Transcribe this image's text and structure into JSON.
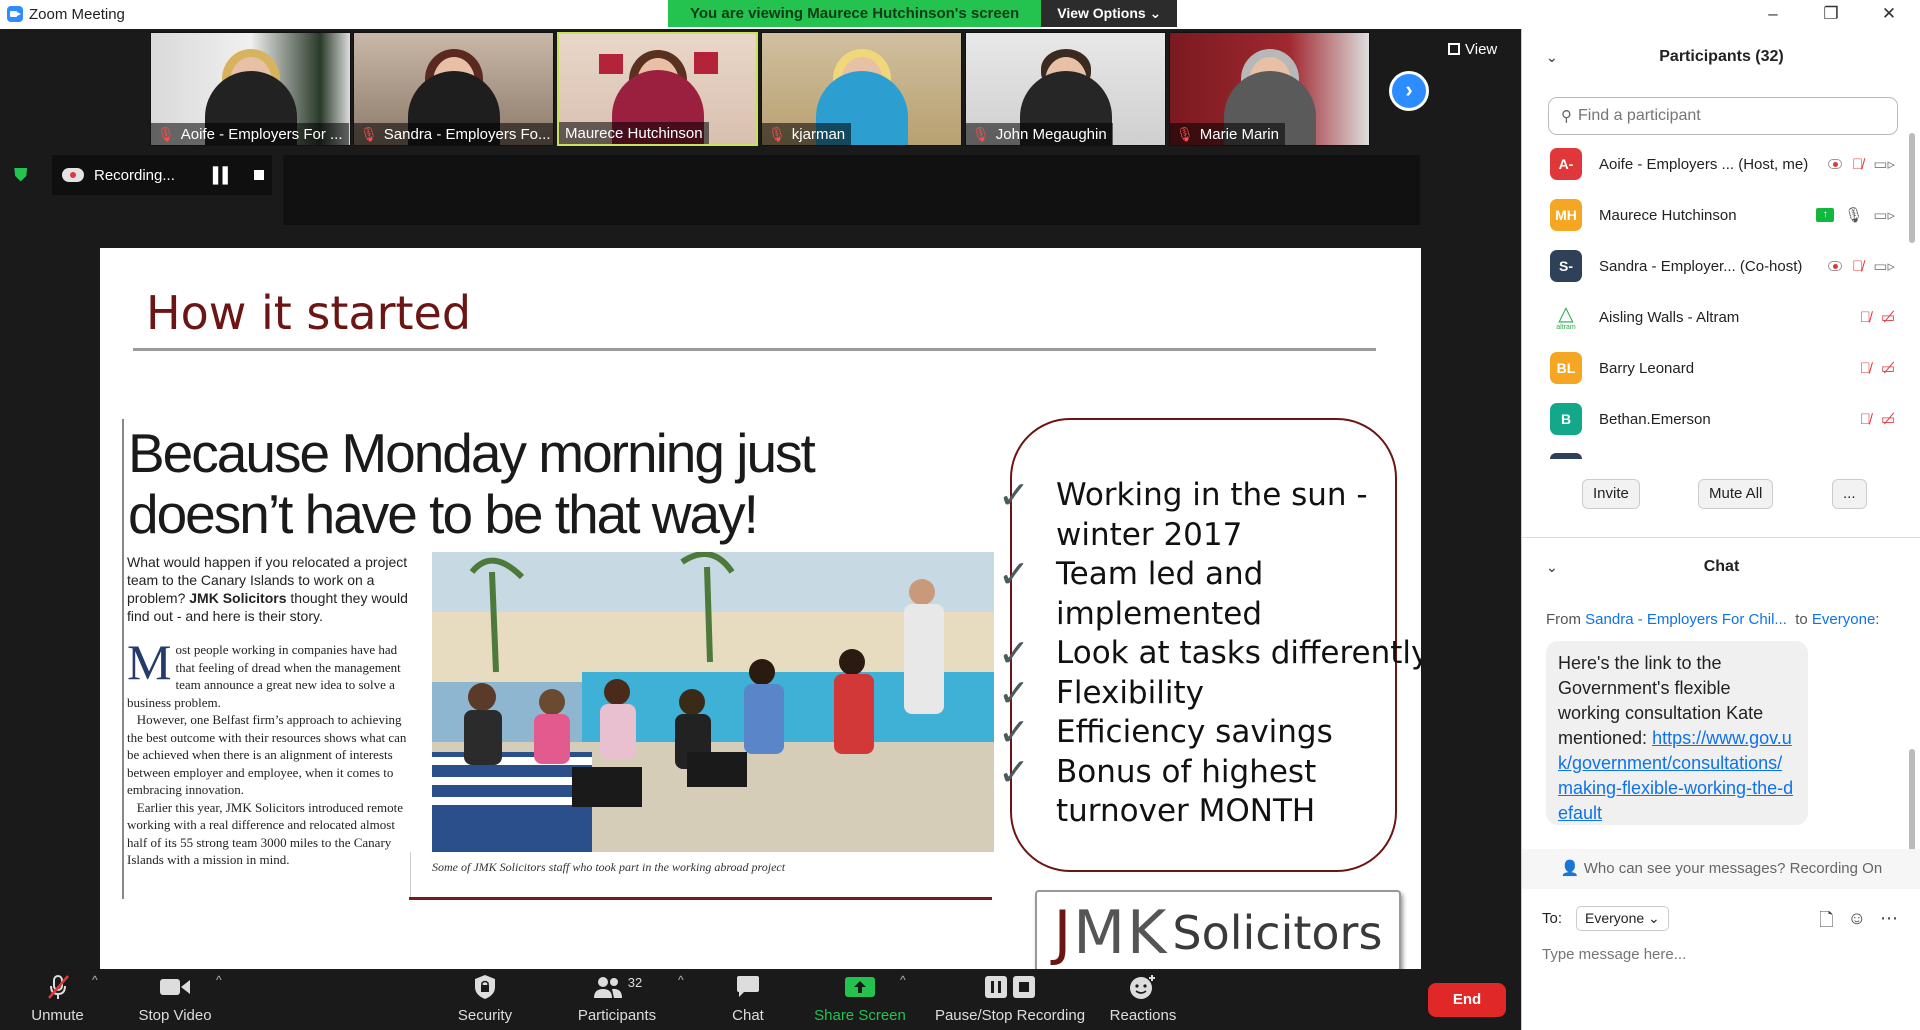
{
  "window": {
    "title": "Zoom Meeting",
    "minimize": "–",
    "maximize": "❐",
    "close": "✕"
  },
  "banner": {
    "text": "You are viewing Maurece Hutchinson's screen",
    "options": "View Options ⌄"
  },
  "thumbnails": [
    {
      "name": "Aoife - Employers For ...",
      "muted": true
    },
    {
      "name": "Sandra - Employers Fo...",
      "muted": true
    },
    {
      "name": "Maurece Hutchinson",
      "muted": false
    },
    {
      "name": "kjarman",
      "muted": true
    },
    {
      "name": "John Megaughin",
      "muted": true
    },
    {
      "name": "Marie Marin",
      "muted": true
    }
  ],
  "view_label": "View",
  "recording": {
    "label": "Recording..."
  },
  "slide": {
    "title": "How it started",
    "article": {
      "headline": "Because Monday morning just doesn’t have to be that way!",
      "intro_a": "What would happen if you relocated a project team to the Canary Islands to work on a problem? ",
      "intro_brand": "JMK Solicitors",
      "intro_b": " thought they would find out - and here is their story.",
      "drop_cap": "M",
      "body_1": "ost people working in companies have had that feeling of dread when the management team announce a great new idea to solve a business problem.",
      "body_2": "However, one Belfast firm’s approach to achieving the best outcome with their resources shows what can be achieved when there is an alignment of interests between employer and employee, when it comes to embracing innovation.",
      "body_3": "Earlier this year, JMK Solicitors introduced remote working with a real difference and relocated almost half of its 55 strong team 3000 miles to the Canary Islands with a mission in mind.",
      "caption": "Some of JMK Solicitors staff who took part in the working abroad project"
    },
    "checklist": [
      {
        "text": "Working in the sun - winter 2017"
      },
      {
        "text": "Team led and implemented"
      },
      {
        "text": "Look at tasks differently"
      },
      {
        "text": "Flexibility"
      },
      {
        "text": "Efficiency savings"
      },
      {
        "text": "Bonus of highest turnover MONTH"
      }
    ],
    "logo": {
      "jmk_j": "J",
      "jmk_mk": "MK",
      "solicitors": "Solicitors"
    }
  },
  "toolbar": {
    "unmute": "Unmute",
    "stop_video": "Stop Video",
    "security": "Security",
    "participants": "Participants",
    "participants_count": "32",
    "chat": "Chat",
    "share_screen": "Share Screen",
    "pause_stop_recording": "Pause/Stop Recording",
    "reactions": "Reactions",
    "end": "End"
  },
  "participants_panel": {
    "header": "Participants (32)",
    "search_placeholder": "Find a participant",
    "list": [
      {
        "initials": "A-",
        "name": "Aoife - Employers ... (Host, me)",
        "color": "#e0373b"
      },
      {
        "initials": "MH",
        "name": "Maurece Hutchinson",
        "color": "#f5a623"
      },
      {
        "initials": "S-",
        "name": "Sandra - Employer... (Co-host)",
        "color": "#2e4158"
      },
      {
        "initials": "",
        "name": "Aisling Walls - Altram",
        "color": "#ffffff",
        "logo_text": "altram"
      },
      {
        "initials": "BL",
        "name": "Barry Leonard",
        "color": "#f5a623"
      },
      {
        "initials": "B",
        "name": "Bethan.Emerson",
        "color": "#13a889"
      }
    ],
    "invite": "Invite",
    "mute_all": "Mute All",
    "more": "..."
  },
  "chat_panel": {
    "header": "Chat",
    "from_prefix": "From ",
    "from_name": "Sandra - Employers For Chil...",
    "to_prefix": "  to ",
    "to_name": "Everyone",
    "to_suffix": ":",
    "message_text": "Here's the link to the Government's flexible working consultation Kate mentioned: ",
    "message_link": "https://www.gov.uk/government/consultations/making-flexible-working-the-default",
    "who_can_see": "Who can see your messages? Recording On",
    "to_label": "To:",
    "to_select": "Everyone ⌄",
    "input_placeholder": "Type message here..."
  },
  "colors": {
    "accent": "#2d8cff",
    "end_red": "#e02828",
    "share_green": "#24c24f",
    "slide_title": "#6b1515"
  }
}
